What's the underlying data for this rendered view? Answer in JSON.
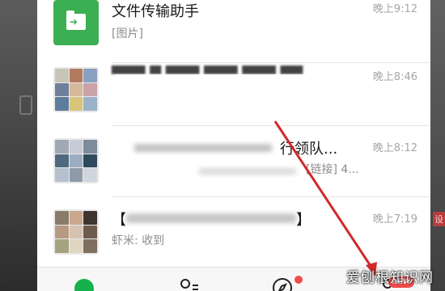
{
  "chats": [
    {
      "name": "文件传输助手",
      "preview": "[图片]",
      "time": "晚上9:12"
    },
    {
      "name": "",
      "preview": "",
      "time": "晚上8:46"
    },
    {
      "name": "行领队...",
      "preview": "[链接] 4...",
      "time": "晚上8:12"
    },
    {
      "name": "【",
      "name_tail": "】",
      "preview": "虾米: 收到",
      "time": "晚上7:19"
    }
  ],
  "tabs": [
    {
      "id": "chats",
      "icon": "chat-bubble-icon"
    },
    {
      "id": "contacts",
      "icon": "contacts-icon"
    },
    {
      "id": "discover",
      "icon": "compass-icon"
    },
    {
      "id": "me",
      "icon": "person-icon"
    }
  ],
  "badges": {
    "discover": "dot",
    "me": "NEW"
  },
  "watermark": "爱刨根知识网",
  "colors": {
    "accent": "#16b14c",
    "file_helper": "#3daf53",
    "badge": "#f04a4a",
    "annotation_arrow": "#d12a2a"
  }
}
